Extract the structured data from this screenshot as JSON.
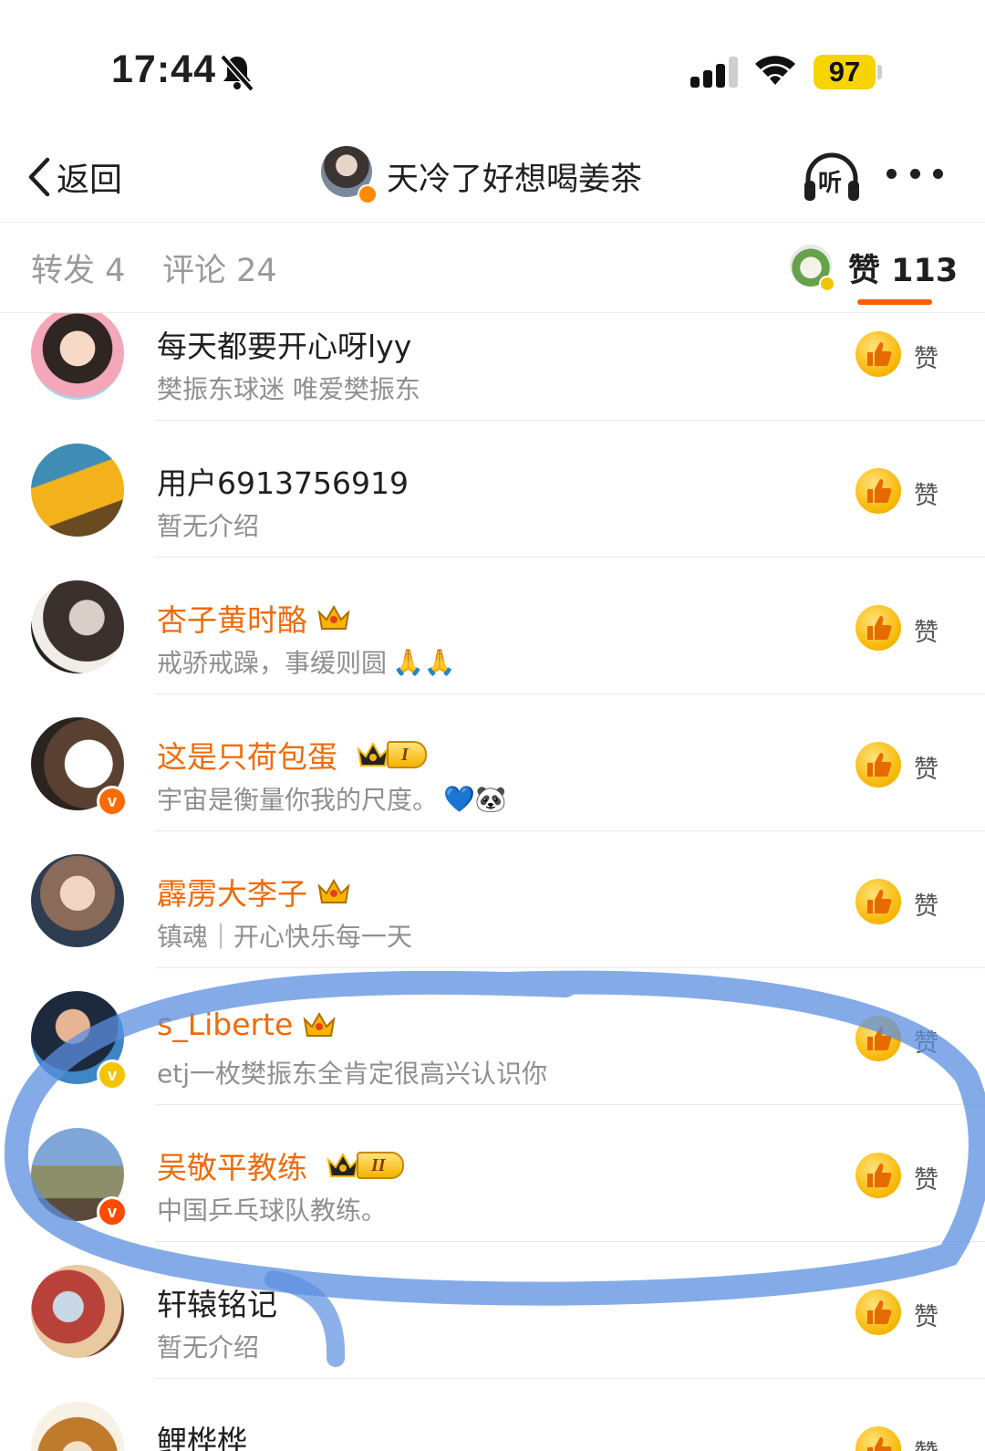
{
  "status_bar": {
    "time": "17:44",
    "battery": "97"
  },
  "nav": {
    "back_label": "返回",
    "title": "天冷了好想喝姜茶",
    "listen_label": "听"
  },
  "tabs": {
    "repost": "转发 4",
    "comment": "评论 24",
    "like": "赞 113"
  },
  "like_label": "赞",
  "likers": [
    {
      "name": "每天都要开心呀lyy",
      "desc": "樊振东球迷 唯爱樊振东"
    },
    {
      "name": "用户6913756919",
      "desc": "暂无介绍"
    },
    {
      "name": "杏子黄时酪",
      "desc": "戒骄戒躁，事缓则圆",
      "desc_emoji": "🙏🙏"
    },
    {
      "name": "这是只荷包蛋",
      "level": "I",
      "desc": "宇宙是衡量你我的尺度。",
      "desc_emoji": "💙🐼"
    },
    {
      "name": "霹雳大李子",
      "desc": "镇魂｜开心快乐每一天"
    },
    {
      "name": "s_Liberte",
      "desc": "etj一枚樊振东全肯定很高兴认识你"
    },
    {
      "name": "吴敬平教练",
      "level": "II",
      "desc": "中国乒乓球队教练。"
    },
    {
      "name": "轩辕铭记",
      "desc": "暂无介绍"
    },
    {
      "name": "鲤桦桦",
      "desc": ""
    }
  ],
  "colors": {
    "vip_name": "#f06b08",
    "accent_tab": "#ff5e00",
    "highlight_stroke": "#5b8fe0",
    "badge_orange": "#ff6a00",
    "badge_gold": "#f5c400"
  }
}
